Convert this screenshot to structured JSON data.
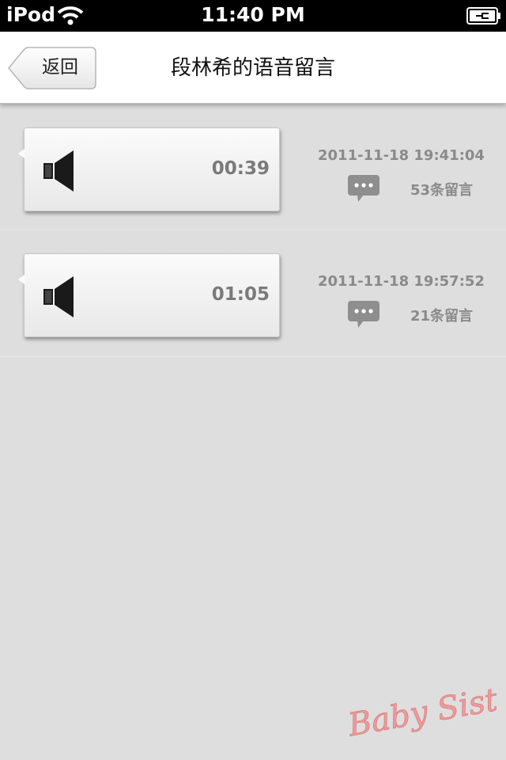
{
  "status_bar": {
    "carrier": "iPod",
    "time": "11:40 PM"
  },
  "nav": {
    "back_label": "返回",
    "title": "段林希的语音留言"
  },
  "messages": [
    {
      "duration": "00:39",
      "timestamp": "2011-11-18  19:41:04",
      "comments": "53条留言"
    },
    {
      "duration": "01:05",
      "timestamp": "2011-11-18  19:57:52",
      "comments": "21条留言"
    }
  ],
  "watermark": {
    "text": "Baby Sister",
    "color": "#e88a8a"
  },
  "colors": {
    "background": "#dedede",
    "nav_background": "#ffffff",
    "meta_text": "#8a8a8a",
    "duration_text": "#7a7a7a"
  }
}
